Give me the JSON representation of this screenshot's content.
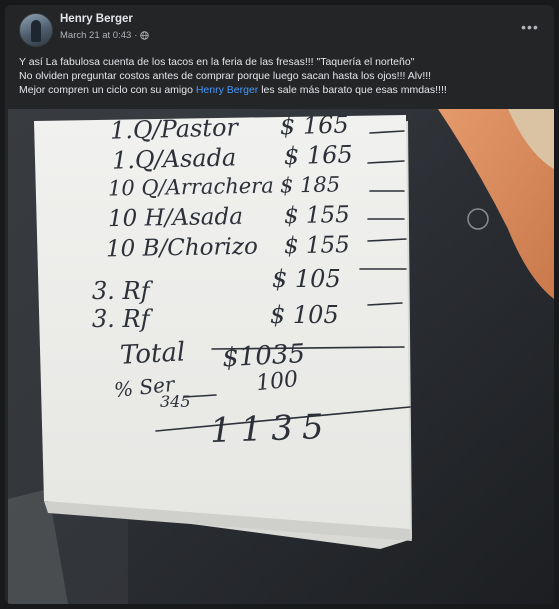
{
  "post": {
    "author": "Henry Berger",
    "timestamp": "March 21 at 0:43",
    "separator": "·",
    "privacy_icon": "globe-icon",
    "more_icon": "more-options-icon",
    "more_label": "•••",
    "text_line1": "Y así La fabulosa cuenta de los tacos en la feria de las fresas!!! \"Taquería el norteño\"",
    "text_line2": "No olviden preguntar costos antes de comprar porque luego sacan hasta los ojos!!!  Alv!!!",
    "text_line3_before": "Mejor compren un ciclo con su amigo ",
    "text_line3_mention": "Henry Berger",
    "text_line3_after": "  les sale más barato que esas mmdas!!!!"
  },
  "receipt": {
    "lines": [
      {
        "item": "1.Q/Pastor",
        "price": "$ 165"
      },
      {
        "item": "1.Q/Asada",
        "price": "$ 165"
      },
      {
        "item": "10 Q/Arrachera",
        "price": "$ 185"
      },
      {
        "item": "10 H/Asada",
        "price": "$ 155"
      },
      {
        "item": "10 B/Chorizo",
        "price": "$ 155"
      },
      {
        "item": "3. Rf",
        "price": "$ 105"
      },
      {
        "item": "3. Rf",
        "price": "$ 105"
      }
    ],
    "total_label": "Total",
    "total_value": "$1035",
    "service_label": "% Ser",
    "service_value": "100",
    "service_note": "345",
    "grand_total": "1135"
  },
  "colors": {
    "background": "#18191a",
    "card": "#242526",
    "text": "#e4e6eb",
    "secondary": "#b0b3b8",
    "mention": "#4599ff",
    "ink": "#2c3038"
  }
}
